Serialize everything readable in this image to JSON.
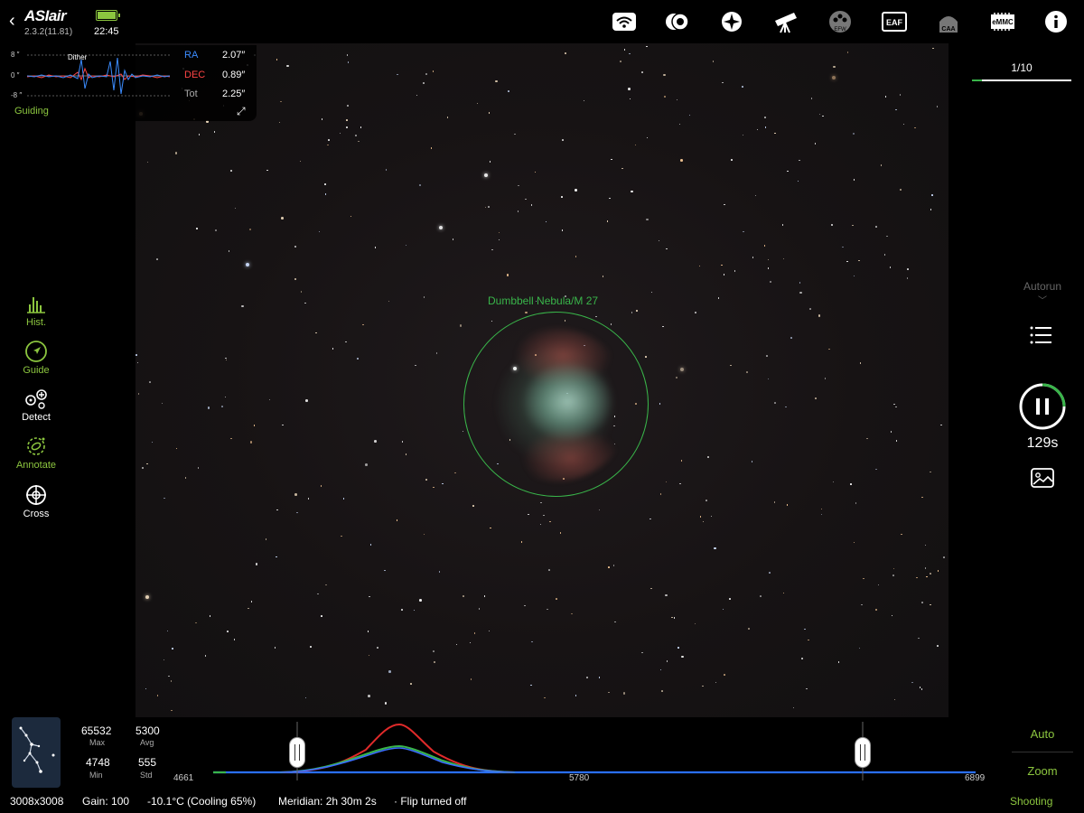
{
  "app": {
    "name": "ASIair",
    "version": "2.3.2(11.81)",
    "clock": "22:45",
    "battery_color": "#8cc63f",
    "accent_green": "#8cc63f"
  },
  "topbar_icons": [
    "wifi-icon",
    "camera-icon",
    "mount-icon",
    "telescope-icon",
    "efw-icon",
    "eaf-icon",
    "caa-icon",
    "emmc-icon",
    "info-icon"
  ],
  "topbar_labels": {
    "efw": "EFW",
    "eaf": "EAF",
    "caa": "CAA",
    "emmc": "eMMC"
  },
  "guiding": {
    "axis_top": "8 ″",
    "axis_mid": "0 ″",
    "axis_bot": "-8 ″",
    "dither_label": "Dither",
    "ra_label": "RA",
    "ra_value": "2.07″",
    "dec_label": "DEC",
    "dec_value": "0.89″",
    "tot_label": "Tot",
    "tot_value": "2.25″",
    "title": "Guiding",
    "ra_color": "#3b8cff",
    "dec_color": "#ff4444"
  },
  "tools": [
    {
      "label": "Hist.",
      "icon": "histogram-icon"
    },
    {
      "label": "Guide",
      "icon": "guide-icon"
    },
    {
      "label": "Detect",
      "icon": "detect-icon"
    },
    {
      "label": "Annotate",
      "icon": "annotate-icon"
    },
    {
      "label": "Cross",
      "icon": "crosshair-icon"
    }
  ],
  "image": {
    "target_label": "Dumbbell Nebula/M 27"
  },
  "right": {
    "frame_counter": "1/10",
    "frame_progress": 0.1,
    "autorun": "Autorun",
    "timer": "129s"
  },
  "stats": {
    "max_value": "65532",
    "max_label": "Max",
    "avg_value": "5300",
    "avg_label": "Avg",
    "min_value": "4748",
    "min_label": "Min",
    "std_value": "555",
    "std_label": "Std"
  },
  "histogram": {
    "tick_left": "4661",
    "tick_mid": "5780",
    "tick_right": "6899"
  },
  "stretch_buttons": {
    "auto": "Auto",
    "zoom": "Zoom"
  },
  "status": {
    "resolution": "3008x3008",
    "gain": "Gain: 100",
    "temp": "-10.1°C (Cooling 65%)",
    "meridian": "Meridian: 2h 30m 2s",
    "flip": "· Flip turned off",
    "mode": "Shooting"
  }
}
